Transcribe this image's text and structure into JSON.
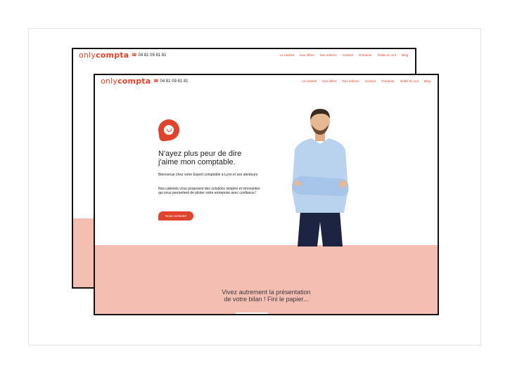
{
  "brand": {
    "logo_light": "only",
    "logo_bold": "compta"
  },
  "phone": "04 81 09 81 81",
  "menu": [
    "Le cabinet",
    "Nos offres",
    "Nos métiers",
    "Contact",
    "Parrainer",
    "Outils et cont",
    "Blog"
  ],
  "hero": {
    "headline_line1": "N'ayez plus peur de dire",
    "headline_line2": "j'aime mon comptable.",
    "intro": "Bienvenue chez votre Expert comptable à Lyon et ses alentours",
    "description": "Nos cabinets vous proposent des solutions simples et innovantes qui vous permettent de piloter votre entreprise avec confiance !",
    "cta": "Nous contacter"
  },
  "section": {
    "tagline_line1": "Vivez autrement la présentation",
    "tagline_line2": "de votre bilan ! Fini le papier..."
  },
  "colors": {
    "accent": "#e0432b",
    "pink": "#f5beb3",
    "shirt": "#b9d3ef",
    "pants": "#1c2441"
  }
}
